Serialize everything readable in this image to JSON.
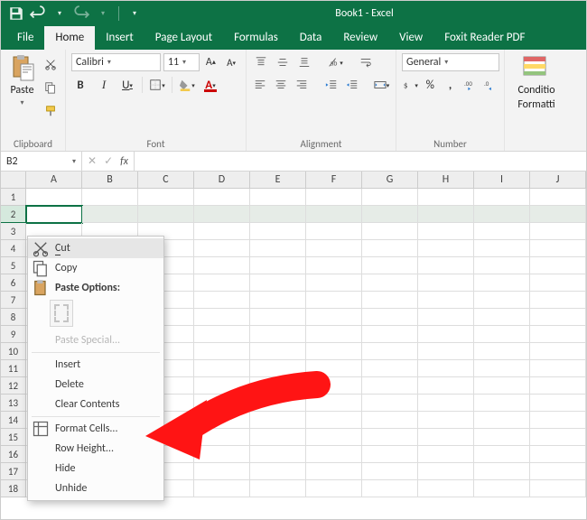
{
  "app": {
    "title": "Book1 - Excel"
  },
  "tabs": [
    "File",
    "Home",
    "Insert",
    "Page Layout",
    "Formulas",
    "Data",
    "Review",
    "View",
    "Foxit Reader PDF"
  ],
  "activeTab": "Home",
  "clipboard": {
    "paste": "Paste",
    "label": "Clipboard"
  },
  "font": {
    "name": "Calibri",
    "size": "11",
    "label": "Font"
  },
  "alignment": {
    "label": "Alignment"
  },
  "number": {
    "format": "General",
    "label": "Number"
  },
  "cond": {
    "line1": "Conditio",
    "line2": "Formatti"
  },
  "nameBox": "B2",
  "columns": [
    "A",
    "B",
    "C",
    "D",
    "E",
    "F",
    "G",
    "H",
    "I",
    "J"
  ],
  "rows": 18,
  "selectedRow": 2,
  "activeCol": 0,
  "ctx": {
    "cut": "Cut",
    "copy": "Copy",
    "pasteOptions": "Paste Options:",
    "pasteSpecial": "Paste Special...",
    "insert": "Insert",
    "delete": "Delete",
    "clear": "Clear Contents",
    "formatCells": "Format Cells...",
    "rowHeight": "Row Height...",
    "hide": "Hide",
    "unhide": "Unhide"
  }
}
